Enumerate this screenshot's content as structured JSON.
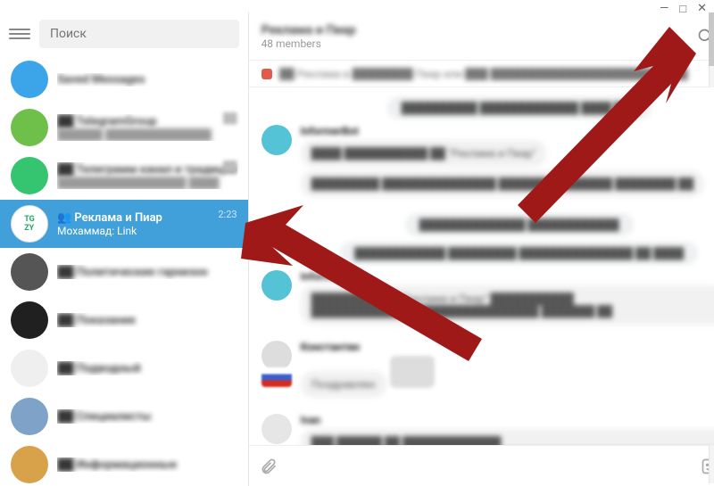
{
  "window": {
    "minimize": "—",
    "maximize": "□",
    "close": "✕"
  },
  "sidebar": {
    "search_placeholder": "Поиск",
    "chats": [
      {
        "title": "Saved Messages",
        "sub": "",
        "time": "",
        "avatar_bg": "#3ca5ea"
      },
      {
        "title": "██ TelegramGroup",
        "sub": "██████ ██████████████",
        "time": "██",
        "avatar_bg": "#6fbf4b"
      },
      {
        "title": "██ Телеграмм канал и традиции",
        "sub": "█████████████████ ████",
        "time": "██",
        "avatar_bg": "#35c470"
      },
      {
        "title": "Реклама и Пиар",
        "sub": "Мохаммад: Link",
        "time": "2:23",
        "avatar_bg": "#ffffff",
        "selected": true
      },
      {
        "title": "██ Политические гарнизон",
        "sub": "",
        "time": "",
        "avatar_bg": "#555555"
      },
      {
        "title": "██ Показание",
        "sub": "",
        "time": "",
        "avatar_bg": "#202020"
      },
      {
        "title": "██ Подводный",
        "sub": "",
        "time": "",
        "avatar_bg": "#f0efef"
      },
      {
        "title": "██ Специалисты",
        "sub": "",
        "time": "",
        "avatar_bg": "#7fa3c8"
      },
      {
        "title": "██ Информационные",
        "sub": "",
        "time": "",
        "avatar_bg": "#d8a24a"
      }
    ]
  },
  "header": {
    "title": "Реклама и Пиар",
    "subtitle": "48 members"
  },
  "pinned": {
    "text": "██ Реклама в ████████ Пиар или ███ ██████████████████████████"
  },
  "messages": [
    {
      "kind": "center",
      "text": "██████████ █████████████ ████ ███"
    },
    {
      "kind": "msg",
      "sender": "InformerBot",
      "avatar": "#55c3d6",
      "bubbles": [
        "████ ███████████ ██ \"Реклама и Пиар\"",
        "█████████ ███████████████ ███████████████ ████████ ██"
      ]
    },
    {
      "kind": "center",
      "text": "██████████████ ████████████"
    },
    {
      "kind": "center",
      "text": "████████████ █████████ ███████████████ ██ ████"
    },
    {
      "kind": "msg",
      "sender": "InformerBot",
      "avatar": "#55c3d6",
      "bubbles": [
        "█████████ ██ \"Реклама и Пиар\" ███████████ ██████████████████████████████ ███████ ██"
      ]
    },
    {
      "kind": "msg",
      "sender": "Константин",
      "avatar": "#dddddd",
      "bubbles": [
        "Поздравляю"
      ],
      "attachment": true,
      "flag": true
    },
    {
      "kind": "msg",
      "sender": "Ivan",
      "avatar": "#e6e6e6",
      "bubbles": [
        "███ ██████ ██ █████████████ ████████████████████████████████████████████████████████████"
      ]
    }
  ]
}
